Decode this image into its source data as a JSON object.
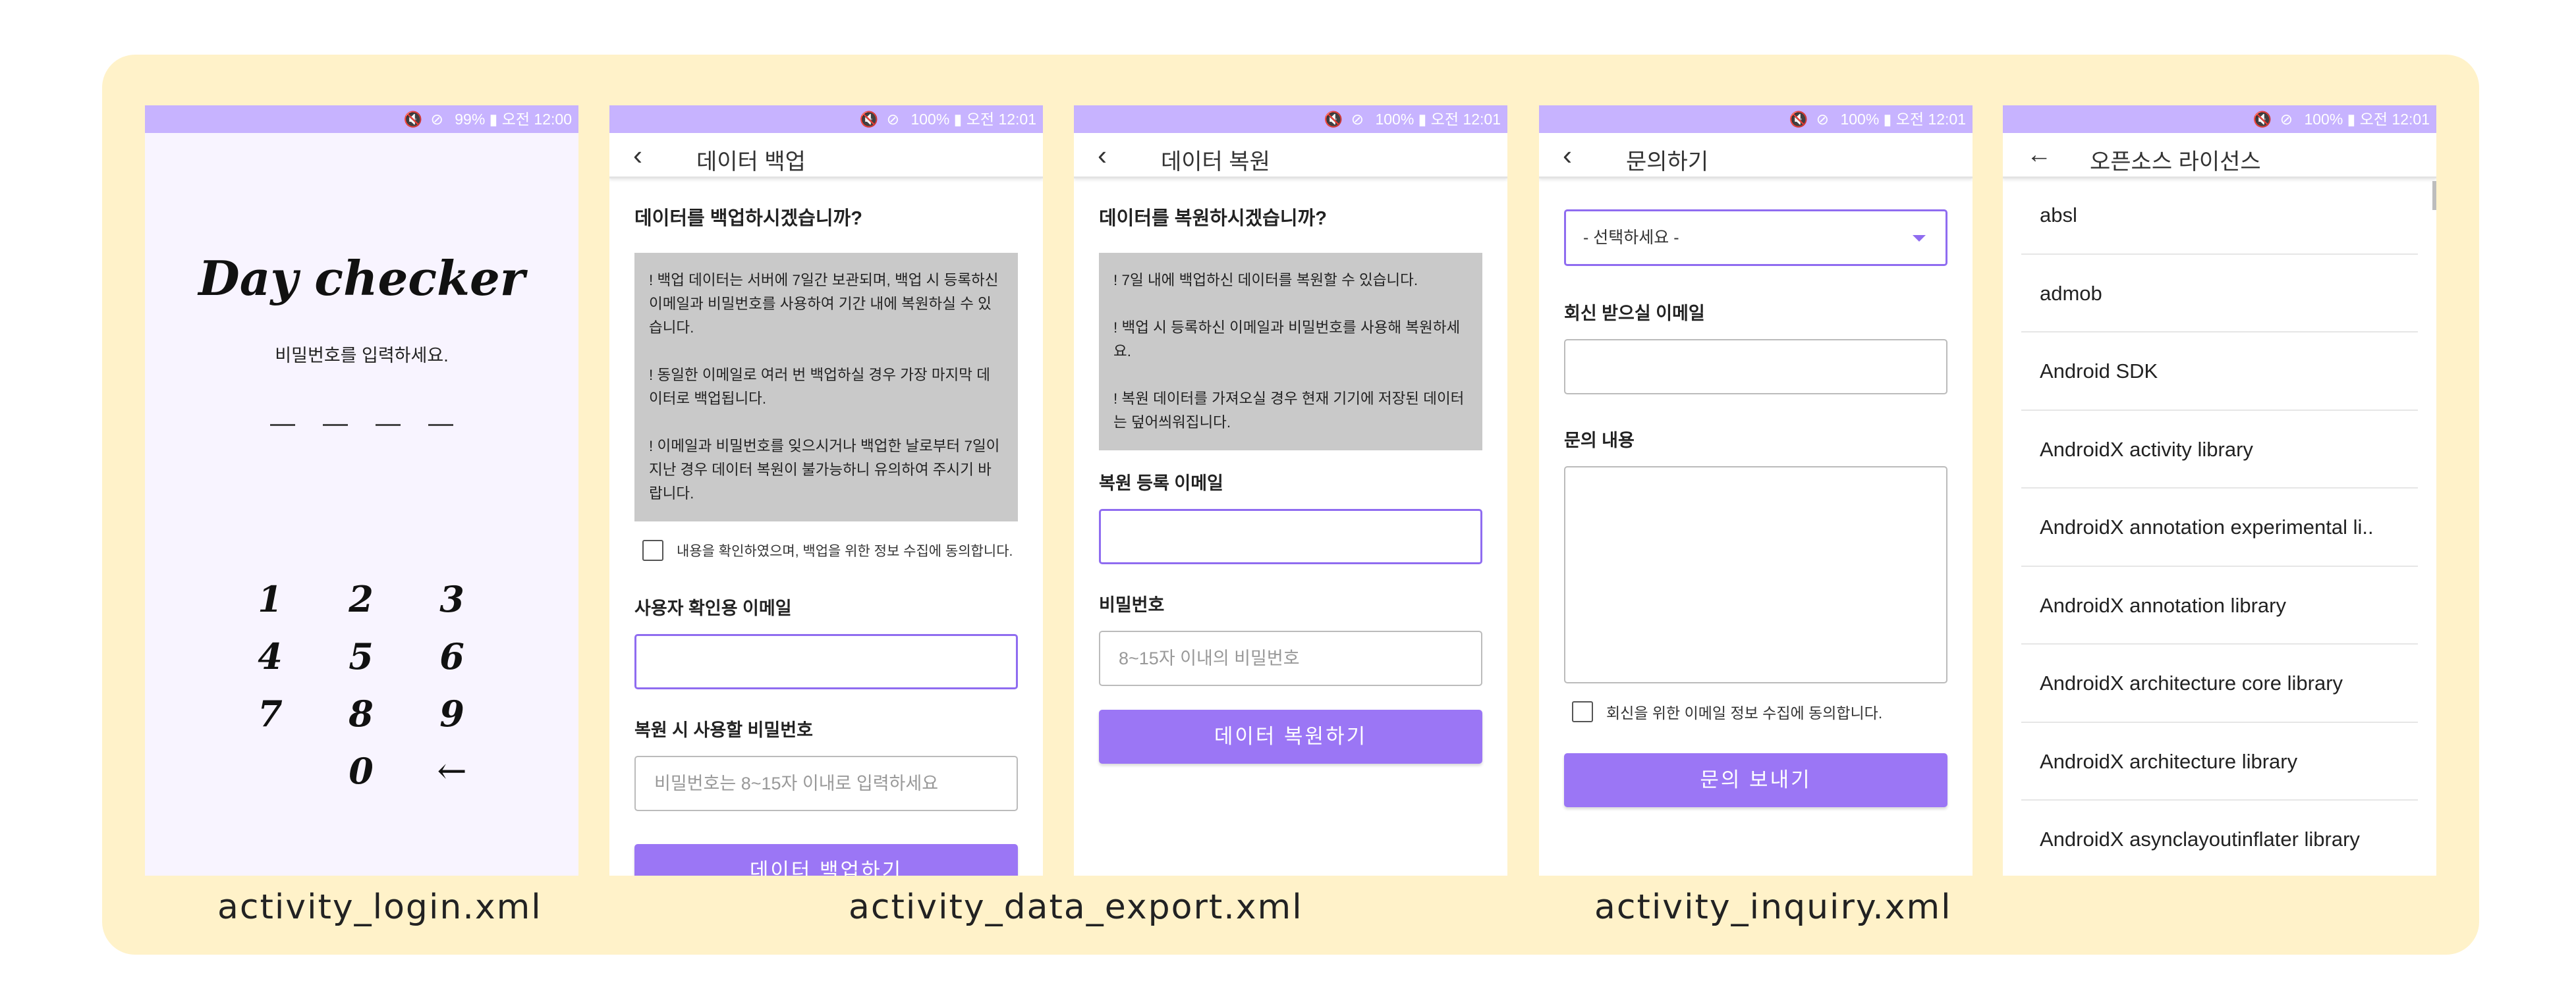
{
  "status": {
    "icons": "🔇 ⊘",
    "login": "99% ▮ 오전 12:00",
    "other": "100% ▮ 오전 12:01"
  },
  "login": {
    "logo": "Day checker",
    "prompt": "비밀번호를 입력하세요.",
    "keys": [
      "1",
      "2",
      "3",
      "4",
      "5",
      "6",
      "7",
      "8",
      "9",
      "0",
      "←"
    ]
  },
  "export": {
    "back": "‹",
    "title": "데이터 백업",
    "question": "데이터를 백업하시겠습니까?",
    "notices": [
      "! 백업 데이터는 서버에 7일간 보관되며, 백업 시 등록하신 이메일과 비밀번호를 사용하여 기간 내에 복원하실 수 있습니다.",
      "! 동일한 이메일로 여러 번 백업하실 경우 가장 마지막 데이터로 백업됩니다.",
      "! 이메일과 비밀번호를 잊으시거나 백업한 날로부터 7일이 지난 경우 데이터 복원이 불가능하니 유의하여 주시기 바랍니다."
    ],
    "agree": "내용을 확인하였으며, 백업을 위한 정보 수집에 동의합니다.",
    "email_label": "사용자 확인용 이메일",
    "email_value": "",
    "password_label": "복원 시 사용할 비밀번호",
    "password_placeholder": "비밀번호는 8~15자 이내로 입력하세요",
    "button": "데이터 백업하기"
  },
  "restore": {
    "back": "‹",
    "title": "데이터 복원",
    "question": "데이터를 복원하시겠습니까?",
    "notices": [
      "! 7일 내에 백업하신 데이터를 복원할 수 있습니다.",
      "! 백업 시 등록하신 이메일과 비밀번호를 사용해 복원하세요.",
      "! 복원 데이터를 가져오실 경우 현재 기기에 저장된 데이터는 덮어씌워집니다."
    ],
    "email_label": "복원 등록 이메일",
    "email_value": "",
    "password_label": "비밀번호",
    "password_placeholder": "8~15자 이내의 비밀번호",
    "button": "데이터 복원하기"
  },
  "inquiry": {
    "back": "‹",
    "title": "문의하기",
    "select_value": "- 선택하세요 -",
    "email_label": "회신 받으실 이메일",
    "email_value": "",
    "content_label": "문의 내용",
    "agree": "회신을 위한 이메일 정보 수집에 동의합니다.",
    "button": "문의 보내기"
  },
  "license": {
    "back": "←",
    "title": "오픈소스 라이선스",
    "items": [
      "absl",
      "admob",
      "Android SDK",
      "AndroidX activity library",
      "AndroidX annotation experimental li..",
      "AndroidX annotation library",
      "AndroidX architecture core library",
      "AndroidX architecture library",
      "AndroidX asynclayoutinflater library"
    ]
  },
  "captions": {
    "login": "activity_login.xml",
    "data_export": "activity_data_export.xml",
    "inquiry": "activity_inquiry.xml"
  }
}
